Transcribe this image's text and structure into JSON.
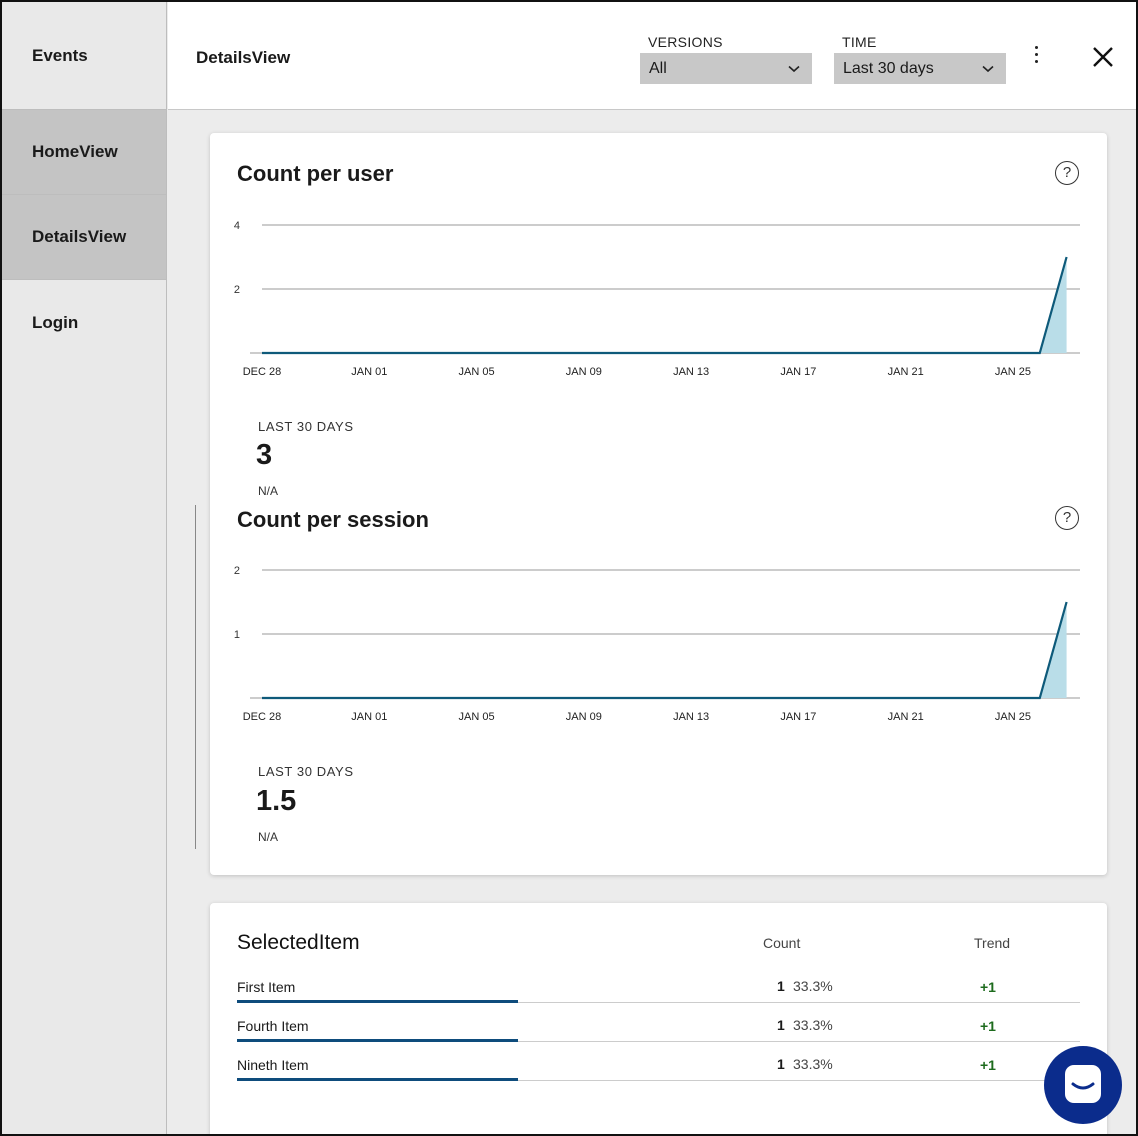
{
  "sidebar": {
    "header": "Events",
    "items": [
      {
        "label": "HomeView"
      },
      {
        "label": "DetailsView"
      },
      {
        "label": "Login"
      }
    ]
  },
  "header": {
    "title": "DetailsView",
    "versions": {
      "label": "VERSIONS",
      "value": "All"
    },
    "time": {
      "label": "TIME",
      "value": "Last 30 days"
    },
    "chevron": "⌄"
  },
  "charts": [
    {
      "title": "Count per user",
      "help_icon": "?",
      "stat_label": "LAST 30 DAYS",
      "stat_value": "3",
      "stat_delta": "N/A"
    },
    {
      "title": "Count per session",
      "help_icon": "?",
      "stat_label": "LAST 30 DAYS",
      "stat_value": "1.5",
      "stat_delta": "N/A"
    }
  ],
  "chart_data": [
    {
      "type": "area",
      "title": "Count per user",
      "x_ticks": [
        "DEC 28",
        "JAN 01",
        "JAN 05",
        "JAN 09",
        "JAN 13",
        "JAN 17",
        "JAN 21",
        "JAN 25"
      ],
      "y_ticks": [
        "4",
        "2"
      ],
      "ylim": [
        0,
        4
      ],
      "x": [
        "DEC 28",
        "JAN 26",
        "JAN 27"
      ],
      "values": [
        0,
        0,
        3
      ],
      "color": "#0e5a7a",
      "fill": "#b9dde8"
    },
    {
      "type": "area",
      "title": "Count per session",
      "x_ticks": [
        "DEC 28",
        "JAN 01",
        "JAN 05",
        "JAN 09",
        "JAN 13",
        "JAN 17",
        "JAN 21",
        "JAN 25"
      ],
      "y_ticks": [
        "2",
        "1"
      ],
      "ylim": [
        0,
        2
      ],
      "x": [
        "DEC 28",
        "JAN 26",
        "JAN 27"
      ],
      "values": [
        0,
        0,
        1.5
      ],
      "color": "#0e5a7a",
      "fill": "#b9dde8"
    }
  ],
  "table": {
    "title": "SelectedItem",
    "col_count": "Count",
    "col_trend": "Trend",
    "rows": [
      {
        "name": "First Item",
        "count": "1",
        "pct": "33.3%",
        "trend": "+1",
        "share": 0.333
      },
      {
        "name": "Fourth Item",
        "count": "1",
        "pct": "33.3%",
        "trend": "+1",
        "share": 0.333
      },
      {
        "name": "Nineth Item",
        "count": "1",
        "pct": "33.3%",
        "trend": "+1",
        "share": 0.333
      }
    ]
  },
  "colors": {
    "accent": "#0e4c7c",
    "trend_positive": "#1d6b1d",
    "chat_button": "#0b2c8c"
  },
  "icons": {
    "more": "kebab-icon",
    "close": "close-icon",
    "help": "help-icon",
    "chat": "chat-icon"
  }
}
